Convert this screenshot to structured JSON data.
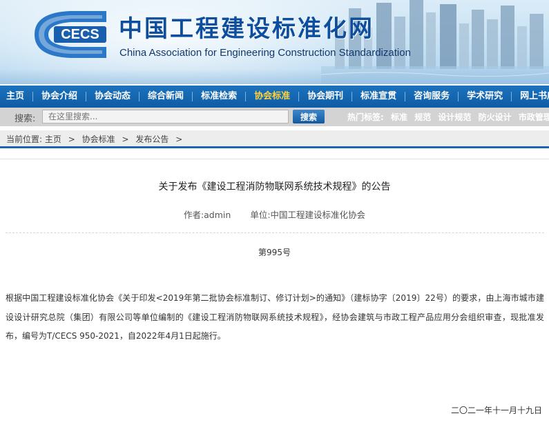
{
  "header": {
    "logo_text": "CECS",
    "title_cn": "中国工程建设标准化网",
    "title_en": "China Association for Engineering Construction Standardization"
  },
  "nav": {
    "items": [
      {
        "label": "主页",
        "active": false
      },
      {
        "label": "协会介绍",
        "active": false
      },
      {
        "label": "协会动态",
        "active": false
      },
      {
        "label": "综合新闻",
        "active": false
      },
      {
        "label": "标准检索",
        "active": false
      },
      {
        "label": "协会标准",
        "active": true
      },
      {
        "label": "协会期刊",
        "active": false
      },
      {
        "label": "标准宣贯",
        "active": false
      },
      {
        "label": "咨询服务",
        "active": false
      },
      {
        "label": "学术研究",
        "active": false
      },
      {
        "label": "网上书店",
        "active": false
      }
    ]
  },
  "search": {
    "label": "搜索:",
    "placeholder": "在这里搜索...",
    "button": "搜索",
    "hot_tags_label": "热门标签:",
    "hot_tags": [
      "标准",
      "规范",
      "设计规范",
      "防火设计",
      "市政管理"
    ]
  },
  "breadcrumb": {
    "prefix": "当前位置:",
    "items": [
      "主页",
      "协会标准",
      "发布公告"
    ],
    "separator": ">"
  },
  "article": {
    "title": "关于发布《建设工程消防物联网系统技术规程》的公告",
    "author": "作者:admin",
    "unit": "单位:中国工程建设标准化协会",
    "number": "第995号",
    "body": "根据中国工程建设标准化协会《关于印发<2019年第二批协会标准制订、修订计划>的通知》（建标协字〔2019〕22号）的要求，由上海市城市建设设计研究总院（集团）有限公司等单位编制的《建设工程消防物联网系统技术规程》，经协会建筑与市政工程产品应用分会组织审查，现批准发布，编号为T/CECS 950-2021，自2022年4月1日起施行。",
    "date": "二〇二一年十一月十九日"
  },
  "colors": {
    "nav_bg": "#1565b0",
    "nav_active": "#ffd33b",
    "title_blue": "#0d4f9e",
    "accent_line": "#1966b0"
  }
}
